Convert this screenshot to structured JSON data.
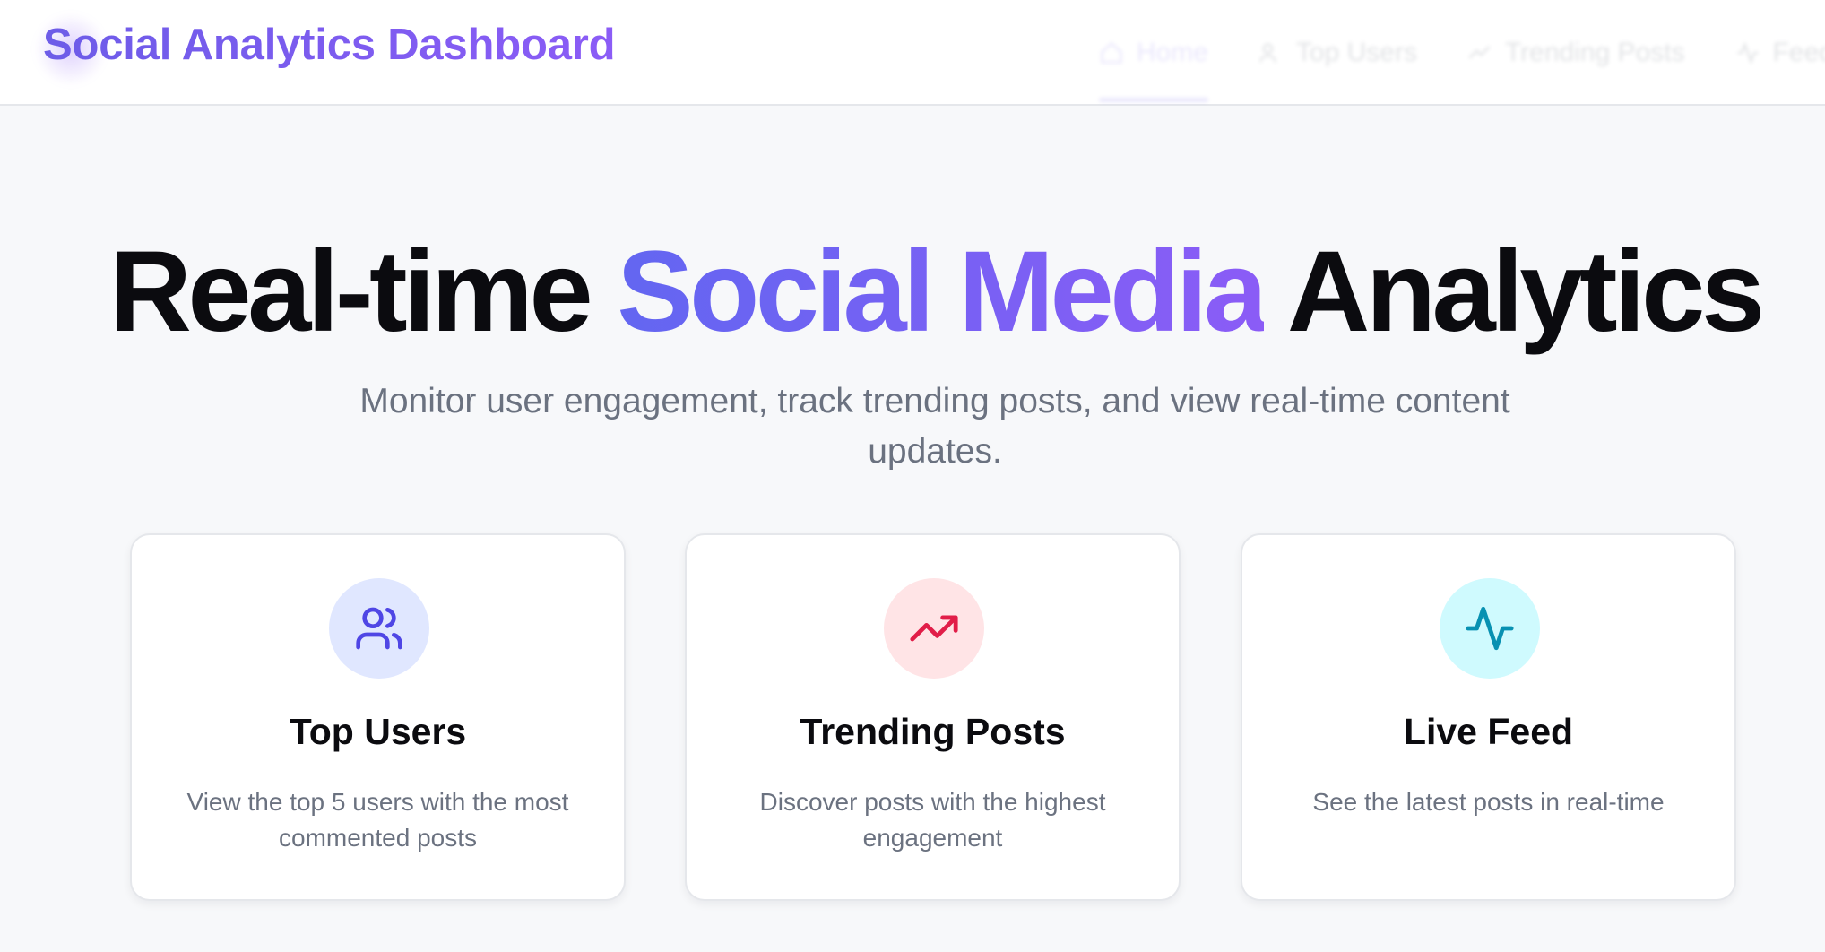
{
  "header": {
    "brand": "Social Analytics Dashboard",
    "nav": [
      {
        "label": "Home",
        "icon": "home-icon"
      },
      {
        "label": "Top Users",
        "icon": "users-icon"
      },
      {
        "label": "Trending Posts",
        "icon": "trending-icon"
      },
      {
        "label": "Feed",
        "icon": "activity-icon"
      }
    ]
  },
  "hero": {
    "title_part1": "Real-time ",
    "title_accent": "Social Media",
    "title_part2": " Analytics",
    "subtitle": "Monitor user engagement, track trending posts, and view real-time content updates."
  },
  "cards": [
    {
      "title": "Top Users",
      "description": "View the top 5 users with the most commented posts",
      "icon": "users-icon",
      "icon_bg": "#e0e7ff",
      "icon_color": "#4f46e5"
    },
    {
      "title": "Trending Posts",
      "description": "Discover posts with the highest engagement",
      "icon": "trending-up-icon",
      "icon_bg": "#ffe4e6",
      "icon_color": "#e11d48"
    },
    {
      "title": "Live Feed",
      "description": "See the latest posts in real-time",
      "icon": "activity-icon",
      "icon_bg": "#cffafe",
      "icon_color": "#0891b2"
    }
  ],
  "colors": {
    "brand": "#6d5ce8",
    "accent_gradient_start": "#6366f1",
    "accent_gradient_end": "#8b5cf6",
    "background": "#f7f8fa"
  }
}
